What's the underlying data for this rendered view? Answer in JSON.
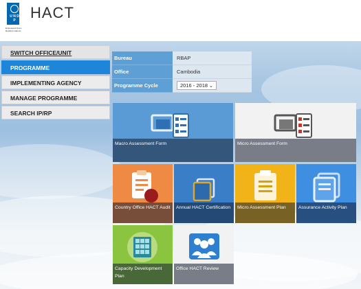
{
  "header": {
    "title": "HACT",
    "logo_letters": "U N D P",
    "logo_tagline": "Empowered lives. Resilient nations."
  },
  "sidebar": {
    "items": [
      {
        "label": "SWITCH OFFICE/UNIT"
      },
      {
        "label": "PROGRAMME"
      },
      {
        "label": "IMPLEMENTING AGENCY"
      },
      {
        "label": "MANAGE PROGRAMME"
      },
      {
        "label": "SEARCH IP/RP"
      }
    ]
  },
  "info": {
    "bureau_label": "Bureau",
    "bureau_value": "RBAP",
    "office_label": "Office",
    "office_value": "Cambodia",
    "cycle_label": "Programme Cycle",
    "cycle_value": "2016 - 2018"
  },
  "tiles": {
    "macro": "Macro Assessment Form",
    "micro": "Micro Assessment Form",
    "co_audit": "Country Office HACT Audit",
    "annual_cert": "Annual HACT Certification",
    "micro_plan": "Micro Assessment Plan",
    "assurance": "Assurance Activity Plan",
    "capacity": "Capacity Development Plan",
    "review": "Office HACT Review"
  },
  "colors": {
    "accent": "#1d86d8",
    "macro_bg": "#5b9bd5",
    "micro_bg": "#f2f2f2",
    "audit_bg": "#ef8a44",
    "annual_bg": "#3a7ec7",
    "plan_bg": "#f2b318",
    "assurance_bg": "#3e8ee2",
    "capacity_bg": "#8bc43f",
    "review_bg": "#f2f2f2"
  }
}
